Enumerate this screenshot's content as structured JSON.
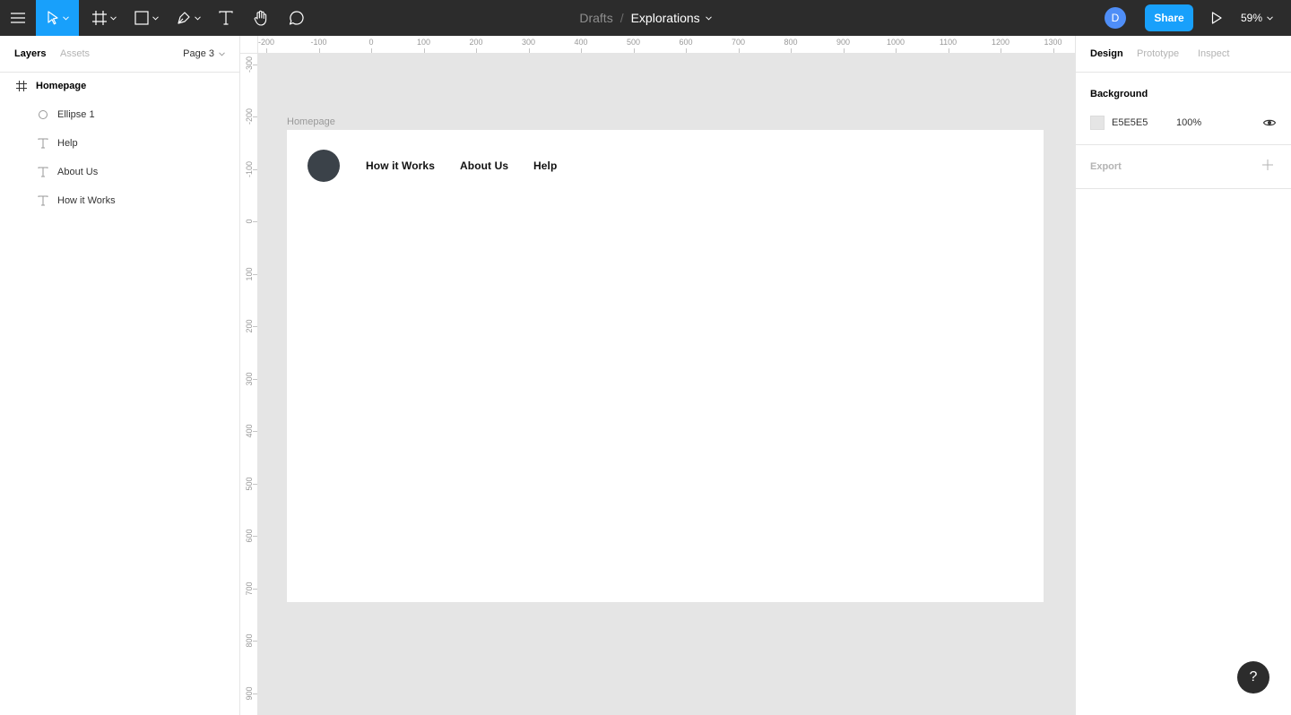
{
  "toolbar": {
    "menu_icon": "hamburger-icon",
    "tools": [
      {
        "name": "move-tool",
        "icon": "cursor-icon",
        "active": true
      },
      {
        "name": "frame-tool",
        "icon": "frame-hash-icon"
      },
      {
        "name": "shape-tool",
        "icon": "rectangle-icon"
      },
      {
        "name": "pen-tool",
        "icon": "pen-icon"
      },
      {
        "name": "text-tool",
        "icon": "text-icon"
      },
      {
        "name": "hand-tool",
        "icon": "hand-icon"
      },
      {
        "name": "comment-tool",
        "icon": "comment-icon"
      }
    ],
    "breadcrumb_parent": "Drafts",
    "breadcrumb_separator": "/",
    "file_name": "Explorations",
    "avatar_initial": "D",
    "share_label": "Share",
    "present_icon": "play-icon",
    "zoom_label": "59%",
    "accent_color": "#18a0fb",
    "bar_color": "#2c2c2c"
  },
  "left_panel": {
    "tab_layers": "Layers",
    "tab_assets": "Assets",
    "page_label": "Page 3",
    "layers": [
      {
        "label": "Homepage",
        "icon": "frame-hash-icon",
        "root": true
      },
      {
        "label": "Ellipse 1",
        "icon": "ellipse-icon"
      },
      {
        "label": "Help",
        "icon": "text-icon"
      },
      {
        "label": "About Us",
        "icon": "text-icon"
      },
      {
        "label": "How it Works",
        "icon": "text-icon"
      }
    ]
  },
  "rulers": {
    "top": [
      "-200",
      "-100",
      "0",
      "100",
      "200",
      "300",
      "400",
      "500",
      "600",
      "700",
      "800",
      "900",
      "1000",
      "1100",
      "1200",
      "1300"
    ],
    "left": [
      "-300",
      "-200",
      "-100",
      "0",
      "100",
      "200",
      "300",
      "400",
      "500",
      "600",
      "700",
      "800",
      "900"
    ]
  },
  "canvas": {
    "background": "#e5e5e5",
    "frame_label": "Homepage",
    "frame": {
      "ellipse_color": "#3b4249",
      "nav_items": [
        "How it Works",
        "About Us",
        "Help"
      ]
    }
  },
  "right_panel": {
    "tab_design": "Design",
    "tab_prototype": "Prototype",
    "tab_inspect": "Inspect",
    "background_title": "Background",
    "background_hex": "E5E5E5",
    "background_opacity": "100%",
    "export_title": "Export"
  },
  "help_label": "?"
}
